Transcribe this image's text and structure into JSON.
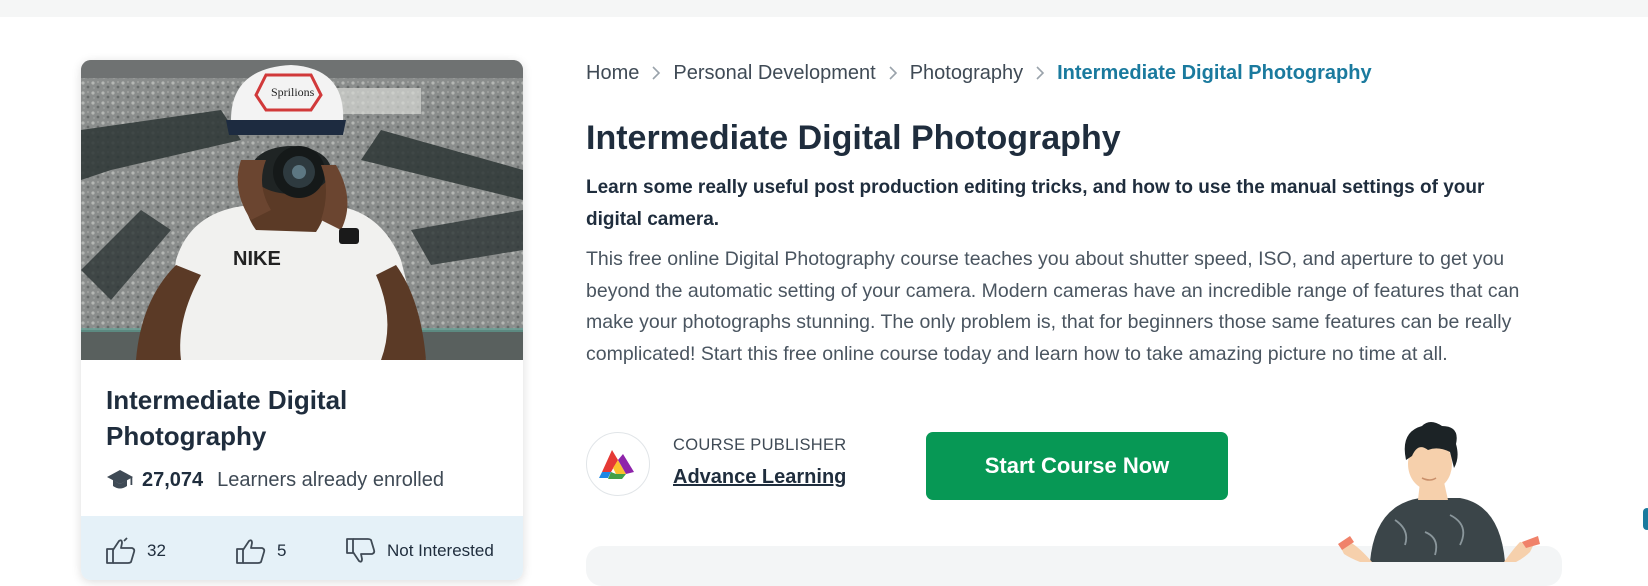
{
  "breadcrumb": {
    "items": [
      "Home",
      "Personal Development",
      "Photography"
    ],
    "current": "Intermediate Digital Photography"
  },
  "card": {
    "title": "Intermediate Digital Photography",
    "enrolled_count": "27,074",
    "enrolled_label": "Learners already enrolled",
    "likes": "32",
    "second_likes": "5",
    "not_interested_label": "Not Interested"
  },
  "course": {
    "title": "Intermediate Digital Photography",
    "tagline": "Learn some really useful post production editing tricks, and how to use the manual settings of your digital camera.",
    "description": "This free online Digital Photography course teaches you about shutter speed, ISO, and aperture to get you beyond the automatic setting of your camera. Modern cameras have an incredible range of features that can make your photographs stunning. The only problem is, that for beginners those same features can be really complicated! Start this free online course today and learn how to take amazing picture no time at all."
  },
  "publisher": {
    "label": "COURSE PUBLISHER",
    "name": "Advance Learning"
  },
  "actions": {
    "start_label": "Start Course Now"
  },
  "icons": {
    "enrolled": "graduation-cap-icon",
    "like": "thumbs-up-icon",
    "dislike": "thumbs-down-icon",
    "breadcrumb_separator": "chevron-right-icon"
  },
  "colors": {
    "primary_button": "#079855",
    "breadcrumb_active": "#1a7a9e",
    "card_footer": "#e5f1f8",
    "heading": "#1f2d3d"
  }
}
